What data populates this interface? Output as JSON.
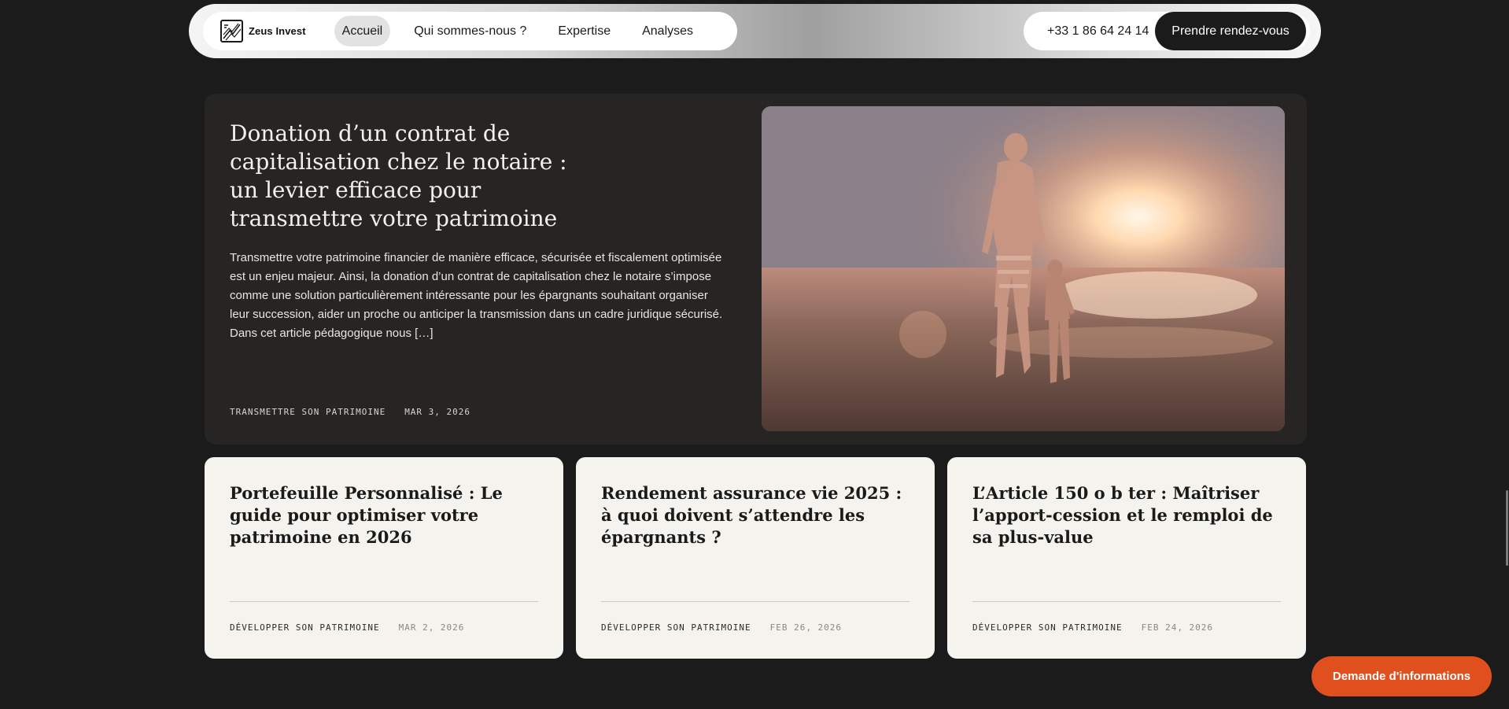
{
  "brand": {
    "name": "Zeus Invest",
    "logo_icon": "zeus-logo-icon"
  },
  "nav": {
    "links": [
      {
        "label": "Accueil",
        "active": true
      },
      {
        "label": "Qui sommes-nous ?",
        "active": false
      },
      {
        "label": "Expertise",
        "active": false
      },
      {
        "label": "Analyses",
        "active": false
      }
    ],
    "phone": "+33 1 86 64 24 14",
    "cta": "Prendre rendez-vous"
  },
  "featured": {
    "title": "Donation d’un contrat de capitalisation chez le notaire : un levier efficace pour transmettre votre patrimoine",
    "excerpt": "Transmettre votre patrimoine financier de manière efficace, sécurisée et fiscalement optimisée est un enjeu majeur. Ainsi, la donation d’un contrat de capitalisation chez le notaire s’impose comme une solution particulièrement intéressante pour les épargnants souhaitant organiser leur succession, aider un proche ou anticiper la transmission dans un cadre juridique sécurisé. Dans cet article pédagogique nous […]",
    "category": "TRANSMETTRE SON PATRIMOINE",
    "date": "MAR 3, 2026",
    "image_icon": "beach-sunset-photo"
  },
  "articles": [
    {
      "title": "Portefeuille Personnalisé : Le guide pour optimiser votre patrimoine en 2026",
      "category": "DÉVELOPPER SON PATRIMOINE",
      "date": "MAR 2, 2026"
    },
    {
      "title": "Rendement assurance vie 2025 : à quoi doivent s’attendre les épargnants ?",
      "category": "DÉVELOPPER SON PATRIMOINE",
      "date": "FEB 26, 2026"
    },
    {
      "title": "L’Article 150 o b ter : Maîtriser l’apport-cession et le remploi de sa plus-value",
      "category": "DÉVELOPPER SON PATRIMOINE",
      "date": "FEB 24, 2026"
    }
  ],
  "floating_cta": "Demande d'informations",
  "colors": {
    "accent": "#e0501f",
    "dark": "#1c1b1b",
    "card": "#f4f3ee"
  }
}
